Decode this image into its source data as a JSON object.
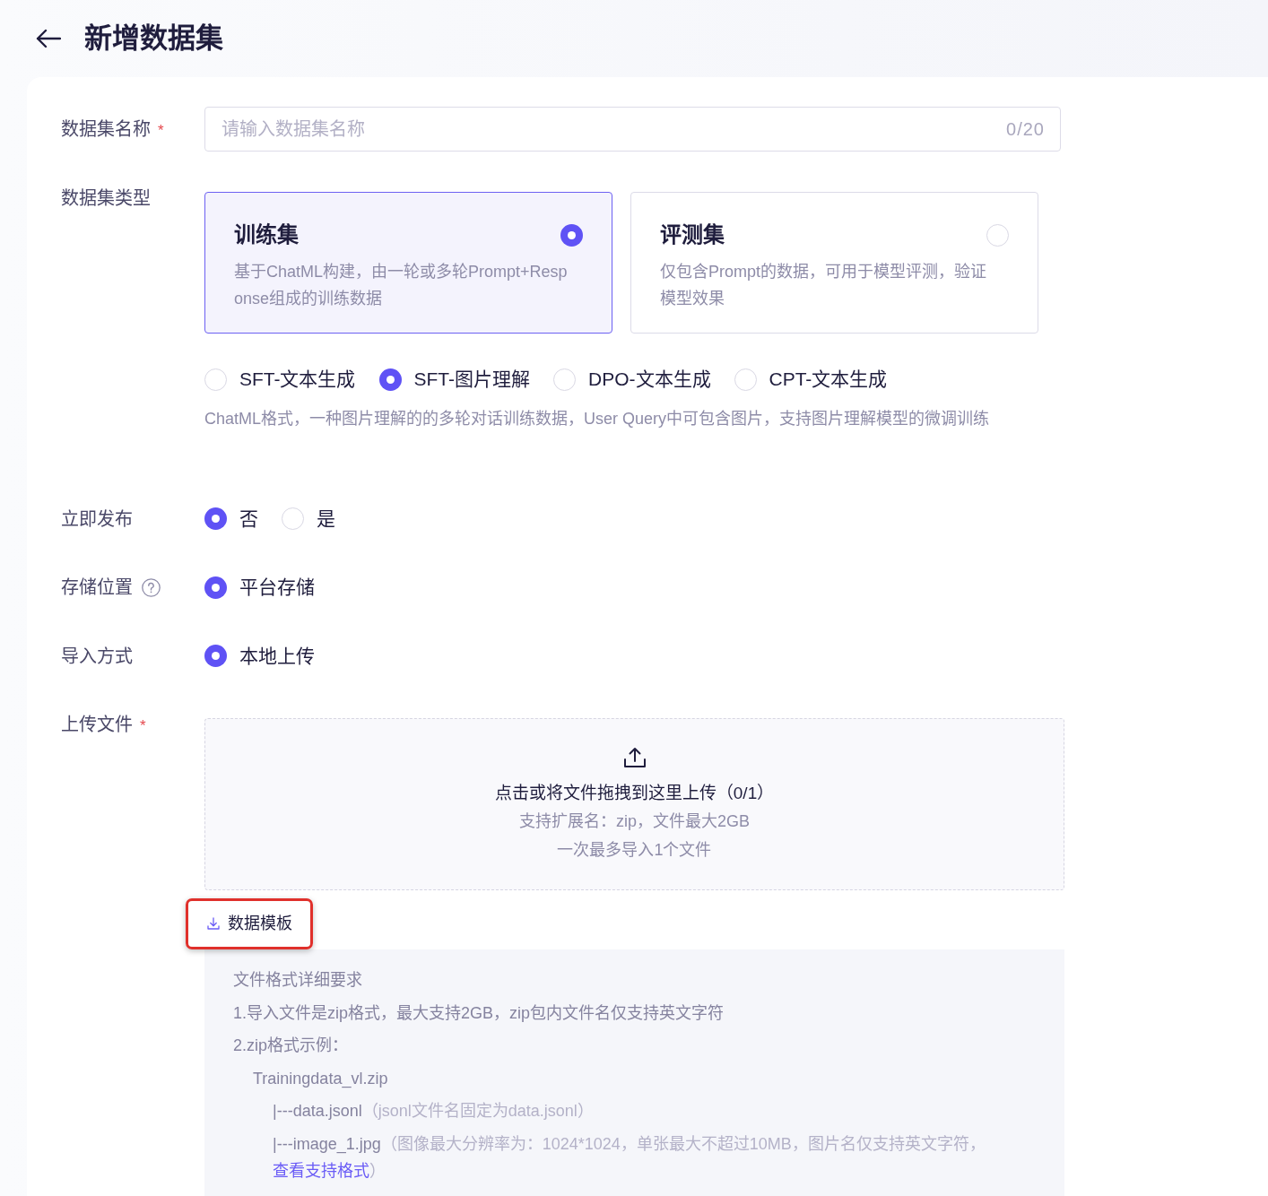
{
  "header": {
    "title": "新增数据集"
  },
  "form": {
    "rows": [
      {
        "kind": "text_input",
        "label": "数据集名称",
        "required_mark": "*",
        "placeholder": "请输入数据集名称",
        "counter": "0/20"
      },
      {
        "kind": "type_cards",
        "label": "数据集类型",
        "cards": [
          {
            "title": "训练集",
            "description": "基于ChatML构建，由一轮或多轮Prompt+Response组成的训练数据",
            "selected": true
          },
          {
            "title": "评测集",
            "description": "仅包含Prompt的数据，可用于模型评测，验证模型效果",
            "selected": false
          }
        ],
        "subtypes": [
          {
            "label": "SFT-文本生成",
            "selected": false
          },
          {
            "label": "SFT-图片理解",
            "selected": true
          },
          {
            "label": "DPO-文本生成",
            "selected": false
          },
          {
            "label": "CPT-文本生成",
            "selected": false
          }
        ],
        "hint": "ChatML格式，一种图片理解的的多轮对话训练数据，User Query中可包含图片，支持图片理解模型的微调训练"
      },
      {
        "kind": "radio",
        "label": "立即发布",
        "options": [
          {
            "label": "否",
            "selected": true
          },
          {
            "label": "是",
            "selected": false
          }
        ]
      },
      {
        "kind": "radio",
        "label": "存储位置",
        "help": true,
        "options": [
          {
            "label": "平台存储",
            "selected": true
          }
        ]
      },
      {
        "kind": "radio",
        "label": "导入方式",
        "options": [
          {
            "label": "本地上传",
            "selected": true
          }
        ]
      },
      {
        "kind": "upload",
        "label": "上传文件",
        "required_mark": "*",
        "dropzone": {
          "title": "点击或将文件拖拽到这里上传（0/1）",
          "hints": [
            "支持扩展名：zip，文件最大2GB",
            "一次最多导入1个文件"
          ]
        },
        "template_link": {
          "label": "数据模板",
          "highlighted": true
        },
        "requirements": {
          "title": "文件格式详细要求",
          "items": [
            {
              "text": "1.导入文件是zip格式，最大支持2GB，zip包内文件名仅支持英文字符"
            },
            {
              "text": "2.zip格式示例：",
              "children": [
                {
                  "text": "Trainingdata_vl.zip",
                  "children": [
                    {
                      "text": "|---data.jsonl",
                      "note": "（jsonl文件名固定为data.jsonl）"
                    },
                    {
                      "text": "|---image_1.jpg",
                      "note": "（图像最大分辨率为：1024*1024，单张最大不超过10MB，图片名仅支持英文字符，",
                      "link": "查看支持格式",
                      "note_end": "）"
                    }
                  ]
                }
              ]
            }
          ]
        }
      }
    ]
  }
}
